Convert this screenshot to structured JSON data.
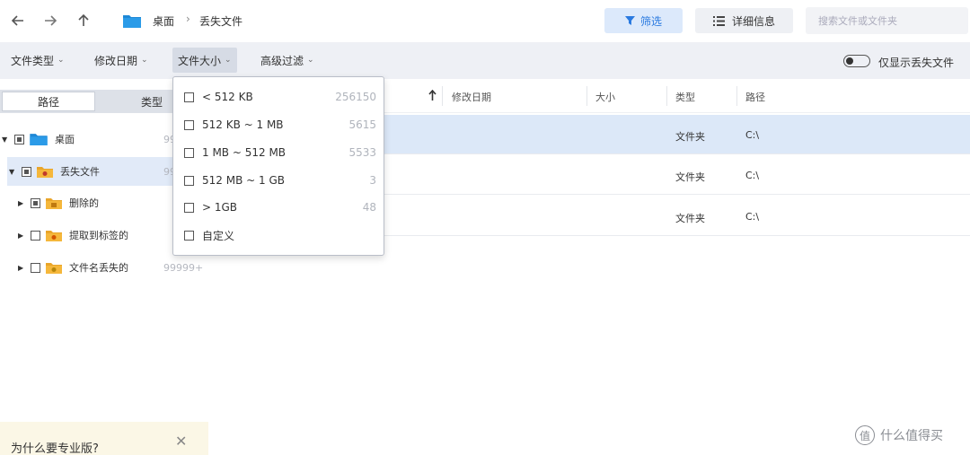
{
  "nav": {
    "back_icon": "back-arrow-icon",
    "forward_icon": "forward-arrow-icon",
    "up_icon": "up-arrow-icon"
  },
  "breadcrumb": [
    "桌面",
    "丢失文件"
  ],
  "toolbar": {
    "filter_label": "筛选",
    "details_label": "详细信息",
    "search_placeholder": "搜索文件或文件夹"
  },
  "filterbar": {
    "items": [
      "文件类型",
      "修改日期",
      "文件大小",
      "高级过滤"
    ],
    "active_index": 2,
    "toggle_label": "仅显示丢失文件"
  },
  "sidebar": {
    "tabs": [
      "路径",
      "类型"
    ],
    "tree": [
      {
        "label": "桌面",
        "count": "99",
        "expanded": true
      },
      {
        "label": "丢失文件",
        "count": "99",
        "expanded": true
      },
      {
        "label": "删除的",
        "count": "",
        "expanded": false
      },
      {
        "label": "提取到标签的",
        "count": "",
        "expanded": false
      },
      {
        "label": "文件名丢失的",
        "count": "99999+",
        "expanded": false
      }
    ],
    "promo_text": "为什么要专业版?"
  },
  "size_dropdown": {
    "options": [
      {
        "label": "< 512 KB",
        "count": "256150"
      },
      {
        "label": "512 KB ~ 1 MB",
        "count": "5615"
      },
      {
        "label": "1 MB ~ 512 MB",
        "count": "5533"
      },
      {
        "label": "512 MB ~ 1 GB",
        "count": "3"
      },
      {
        "label": "> 1GB",
        "count": "48"
      },
      {
        "label": "自定义",
        "count": ""
      }
    ]
  },
  "table": {
    "columns": [
      "修改日期",
      "大小",
      "类型",
      "路径"
    ],
    "rows": [
      {
        "type": "文件夹",
        "path": "C:\\"
      },
      {
        "type": "文件夹",
        "path": "C:\\"
      },
      {
        "type": "文件夹",
        "path": "C:\\"
      }
    ]
  },
  "watermark": "什么值得买",
  "colors": {
    "accent": "#2a7ae0",
    "filter_bg": "#dce9fb",
    "folder_blue": "#1e88d6",
    "folder_yellow": "#f5b73b",
    "selected_row": "#dce8f8"
  }
}
